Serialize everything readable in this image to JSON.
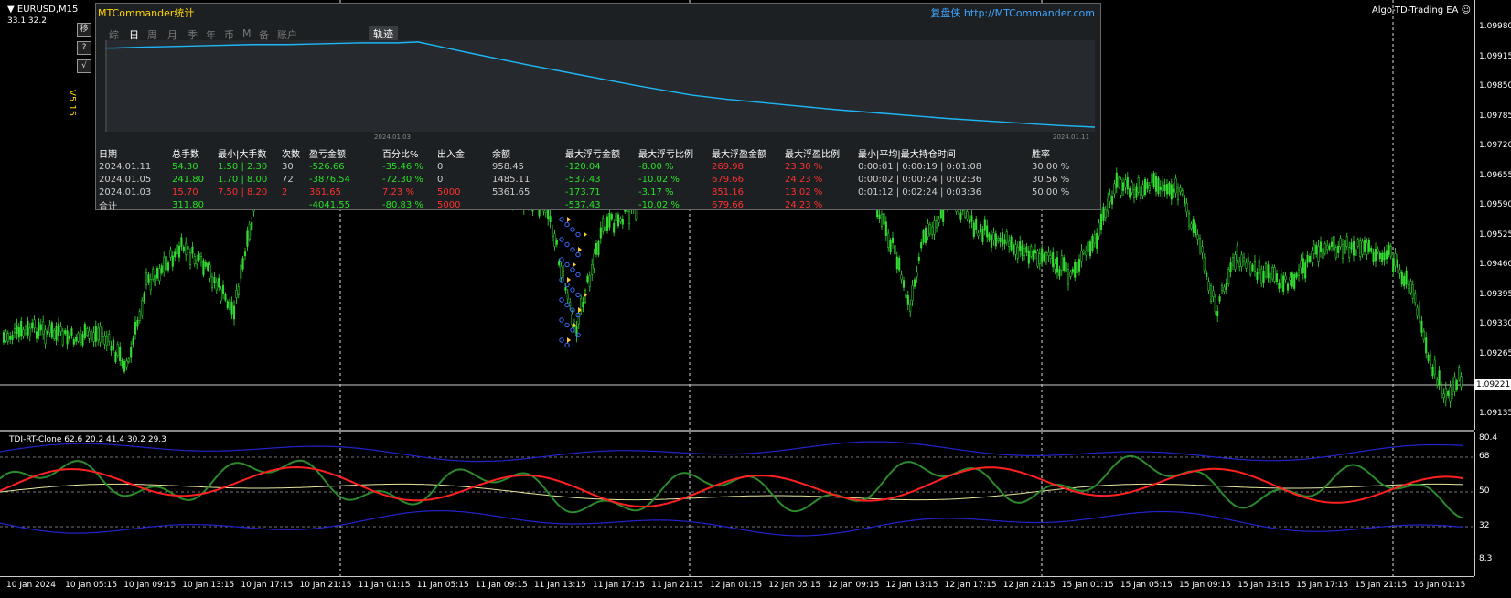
{
  "chart": {
    "symbol": "EURUSD,M15",
    "ohlc_info": "33.1 32.2",
    "ea_name": "Algo-TD-Trading EA ☺",
    "price_ticks": [
      "1.09980",
      "1.09915",
      "1.09850",
      "1.09785",
      "1.09720",
      "1.09655",
      "1.09590",
      "1.09525",
      "1.09460",
      "1.09395",
      "1.09330",
      "1.09265",
      "1.09200",
      "1.09135"
    ],
    "current_price": "1.09221",
    "time_ticks": [
      "10 Jan 2024",
      "10 Jan 05:15",
      "10 Jan 09:15",
      "10 Jan 13:15",
      "10 Jan 17:15",
      "10 Jan 21:15",
      "11 Jan 01:15",
      "11 Jan 05:15",
      "11 Jan 09:15",
      "11 Jan 13:15",
      "11 Jan 17:15",
      "11 Jan 21:15",
      "12 Jan 01:15",
      "12 Jan 05:15",
      "12 Jan 09:15",
      "12 Jan 13:15",
      "12 Jan 17:15",
      "12 Jan 21:15",
      "15 Jan 01:15",
      "15 Jan 05:15",
      "15 Jan 09:15",
      "15 Jan 13:15",
      "15 Jan 17:15",
      "15 Jan 21:15",
      "16 Jan 01:15"
    ],
    "colors": {
      "candle": "#33dd33",
      "indicator_green": "#2a7a2a",
      "indicator_red": "#ff2020",
      "indicator_yellow": "#e8e8a0",
      "indicator_blue": "#2020d0"
    }
  },
  "indicator": {
    "label": "TDI-RT-Clone 62.6 20.2 41.4 30.2 29.3",
    "levels": [
      "80.4",
      "68",
      "50",
      "32",
      "8.3"
    ]
  },
  "panel": {
    "title": "MTCommander统计",
    "site_cn": "复盘侠",
    "site_url": "http://MTCommander.com",
    "version": "V5.15",
    "side_buttons": [
      "移",
      "?",
      "√"
    ],
    "tabs": [
      "综",
      "日",
      "周",
      "月",
      "季",
      "年",
      "币",
      "M",
      "备",
      "账户"
    ],
    "active_tab": "日",
    "track_tab": "轨迹",
    "mini_dates": [
      "2024.01.03",
      "2024.01.11"
    ],
    "headers": [
      "日期",
      "总手数",
      "最小|大手数",
      "次数",
      "盈亏金额",
      "百分比%",
      "出入金",
      "余额",
      "最大浮亏金额",
      "最大浮亏比例",
      "最大浮盈金额",
      "最大浮盈比例",
      "最小|平均|最大持仓时间",
      "胜率"
    ],
    "rows": [
      [
        "2024.01.11",
        "54.30",
        "1.50 | 2.30",
        "30",
        "-526.66",
        "-35.46 %",
        "0",
        "958.45",
        "-120.04",
        "-8.00 %",
        "269.98",
        "23.30 %",
        "0:00:01 | 0:00:19 | 0:01:08",
        "30.00 %"
      ],
      [
        "2024.01.05",
        "241.80",
        "1.70 | 8.00",
        "72",
        "-3876.54",
        "-72.30 %",
        "0",
        "1485.11",
        "-537.43",
        "-10.02 %",
        "679.66",
        "24.23 %",
        "0:00:02 | 0:00:24 | 0:02:36",
        "30.56 %"
      ],
      [
        "2024.01.03",
        "15.70",
        "7.50 | 8.20",
        "2",
        "361.65",
        "7.23 %",
        "5000",
        "5361.65",
        "-173.71",
        "-3.17 %",
        "851.16",
        "13.02 %",
        "0:01:12 | 0:02:24 | 0:03:36",
        "50.00 %"
      ]
    ],
    "total": [
      "合计",
      "311.80",
      "",
      "",
      "-4041.55",
      "-80.83 %",
      "5000",
      "",
      "-537.43",
      "-10.02 %",
      "679.66",
      "24.23 %",
      "",
      ""
    ]
  }
}
